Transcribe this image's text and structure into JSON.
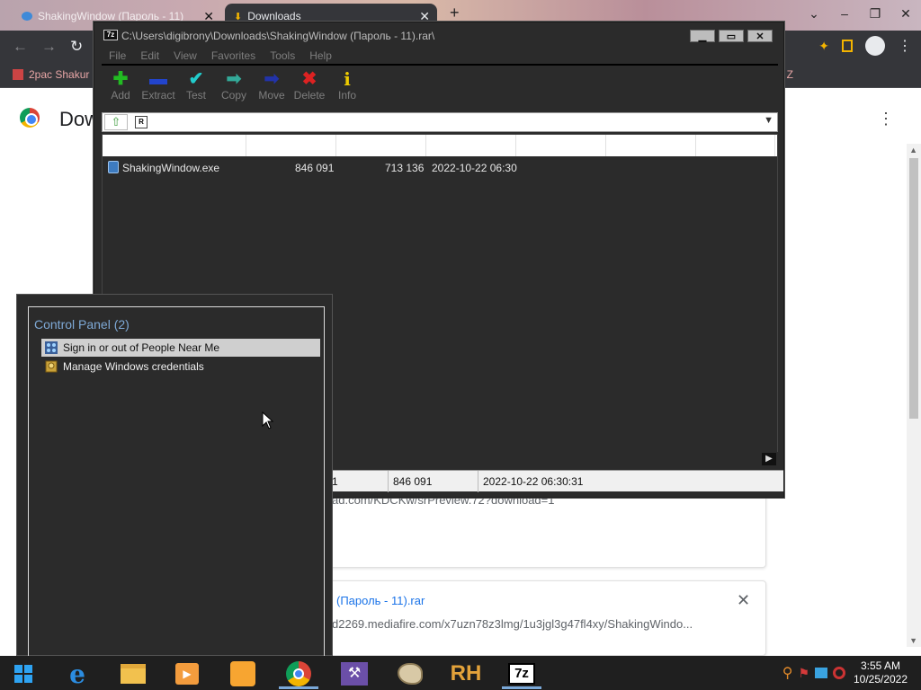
{
  "chrome": {
    "tabs": [
      {
        "title": "ShakingWindow (Пароль - 11)",
        "close": "✕"
      },
      {
        "title": "Downloads",
        "close": "✕"
      }
    ],
    "new_tab": "+",
    "bookmark": "2pac Shakur",
    "bookmark_right": "Z",
    "page_title": "Dow",
    "downloads": {
      "card1_url": "ad.com/KDCKw/srPreview.72?download=1",
      "card2_name": "(Пароль - 11).rar",
      "card2_url": "d2269.mediafire.com/x7uzn78z3lmg/1u3jgl3g47fl4xy/ShakingWindo..."
    }
  },
  "zip": {
    "title": "C:\\Users\\digibrony\\Downloads\\ShakingWindow (Пароль - 11).rar\\",
    "menu": [
      "File",
      "Edit",
      "View",
      "Favorites",
      "Tools",
      "Help"
    ],
    "toolbar": [
      {
        "label": "Add",
        "icon": "plus-icon",
        "glyph": "✚",
        "color": "#22bb22"
      },
      {
        "label": "Extract",
        "icon": "minus-icon",
        "glyph": "▬",
        "color": "#2244cc"
      },
      {
        "label": "Test",
        "icon": "check-icon",
        "glyph": "✔",
        "color": "#22cccc"
      },
      {
        "label": "Copy",
        "icon": "copy-arrow-icon",
        "glyph": "➡",
        "color": "#33aa99"
      },
      {
        "label": "Move",
        "icon": "move-arrow-icon",
        "glyph": "➡",
        "color": "#2233aa"
      },
      {
        "label": "Delete",
        "icon": "delete-x-icon",
        "glyph": "✖",
        "color": "#dd2222"
      },
      {
        "label": "Info",
        "icon": "info-icon",
        "glyph": "i",
        "color": "#eecc00"
      }
    ],
    "file": {
      "name": "ShakingWindow.exe",
      "size": "846 091",
      "packed": "713 136",
      "modified": "2022-10-22 06:30"
    },
    "status": {
      "selected": "1",
      "size": "846 091",
      "modified": "2022-10-22 06:30:31"
    }
  },
  "search": {
    "heading": "Control Panel (2)",
    "items": [
      {
        "label": "Sign in or out of People Near Me",
        "icon": "people-near-me-icon"
      },
      {
        "label": "Manage Windows credentials",
        "icon": "credential-manager-icon"
      }
    ]
  },
  "taskbar": {
    "apps": [
      "start-button",
      "internet-explorer",
      "file-explorer",
      "media-player",
      "uc-browser",
      "chrome",
      "visual-studio",
      "paint",
      "resource-hacker",
      "7-zip"
    ],
    "time": "3:55 AM",
    "date": "10/25/2022"
  }
}
